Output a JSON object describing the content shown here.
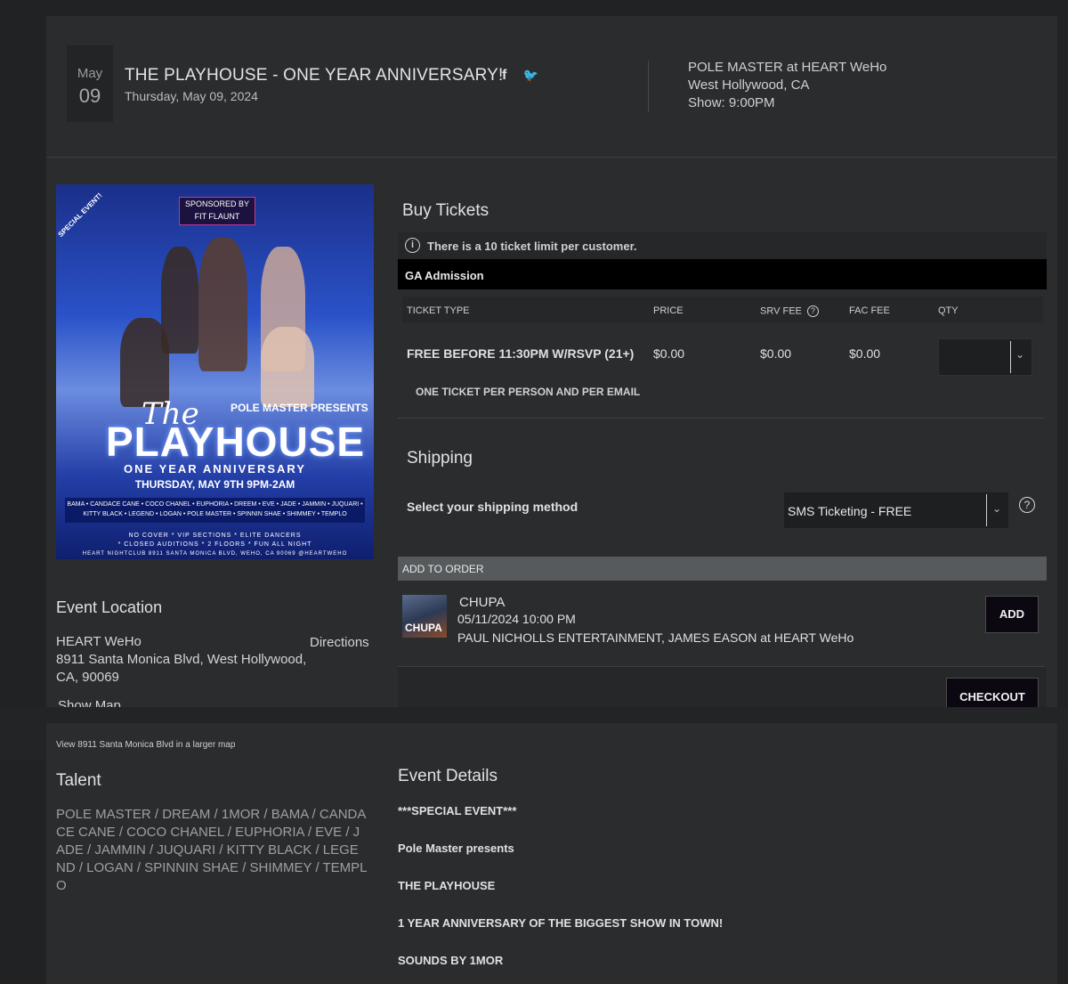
{
  "header": {
    "month": "May",
    "day": "09",
    "title": "THE PLAYHOUSE - ONE YEAR ANNIVERSARY!",
    "date": "Thursday, May 09, 2024",
    "social": {
      "facebook": "f",
      "twitter": "🐦"
    },
    "venue_line1": "POLE MASTER at HEART WeHo",
    "venue_line2": "West Hollywood, CA",
    "venue_line3": "Show: 9:00PM"
  },
  "poster": {
    "ribbon": "SPECIAL EVENT!",
    "sponsor": "SPONSORED BY FIT FLAUNT",
    "presents": "POLE MASTER PRESENTS",
    "the": "The",
    "playhouse": "PLAYHOUSE",
    "anniversary": "ONE YEAR ANNIVERSARY",
    "when": "THURSDAY, MAY 9TH 9PM-2AM",
    "names": "BAMA • CANDACE CANE • COCO CHANEL • EUPHORIA • DREEM • EVE • JADE • JAMMIN • JUQUARI • KITTY BLACK • LEGEND • LOGAN • POLE MASTER • SPINNIN SHAE • SHIMMEY • TEMPLO",
    "footer1": "NO COVER * VIP SECTIONS * ELITE DANCERS",
    "footer2": "* CLOSED AUDITIONS * 2 FLOORS * FUN ALL NIGHT",
    "footer3": "HEART NIGHTCLUB 8911 SANTA MONICA BLVD, WEHO, CA 90069 @HEARTWEHO"
  },
  "location": {
    "heading": "Event Location",
    "name": "HEART WeHo",
    "directions": "Directions",
    "address": "8911 Santa Monica Blvd, West Hollywood, CA, 90069",
    "show_map": "Show Map",
    "larger_map": "View  8911 Santa Monica Blvd  in a larger map"
  },
  "talent": {
    "heading": "Talent",
    "list": "POLE MASTER / DREAM / 1MOR / BAMA / CANDACE CANE / COCO CHANEL / EUPHORIA / EVE / JADE / JAMMIN / JUQUARI / KITTY BLACK / LEGEND / LOGAN / SPINNIN SHAE / SHIMMEY / TEMPLO"
  },
  "tickets": {
    "heading": "Buy Tickets",
    "limit": "There is a 10 ticket limit per customer.",
    "section": "GA Admission",
    "columns": {
      "type": "TICKET TYPE",
      "price": "PRICE",
      "srv": "SRV FEE",
      "fac": "FAC FEE",
      "qty": "QTY"
    },
    "row": {
      "type": "FREE BEFORE 11:30PM W/RSVP (21+)",
      "price": "$0.00",
      "srv": "$0.00",
      "fac": "$0.00",
      "qty": ""
    },
    "note": "ONE TICKET PER PERSON AND PER EMAIL"
  },
  "shipping": {
    "heading": "Shipping",
    "label": "Select your shipping method",
    "selected": "SMS Ticketing - FREE"
  },
  "add_to_order": {
    "heading": "ADD TO ORDER",
    "image_text": "CHUPA",
    "title": "CHUPA",
    "datetime": "05/11/2024 10:00 PM",
    "presenter": "PAUL NICHOLLS ENTERTAINMENT, JAMES EASON at HEART WeHo",
    "add_label": "ADD",
    "checkout_label": "CHECKOUT"
  },
  "details": {
    "heading": "Event Details",
    "lines": [
      "***SPECIAL EVENT***",
      "Pole Master presents",
      "THE PLAYHOUSE",
      "1 YEAR ANNIVERSARY OF THE BIGGEST SHOW IN TOWN!",
      "SOUNDS BY 1MOR"
    ]
  }
}
